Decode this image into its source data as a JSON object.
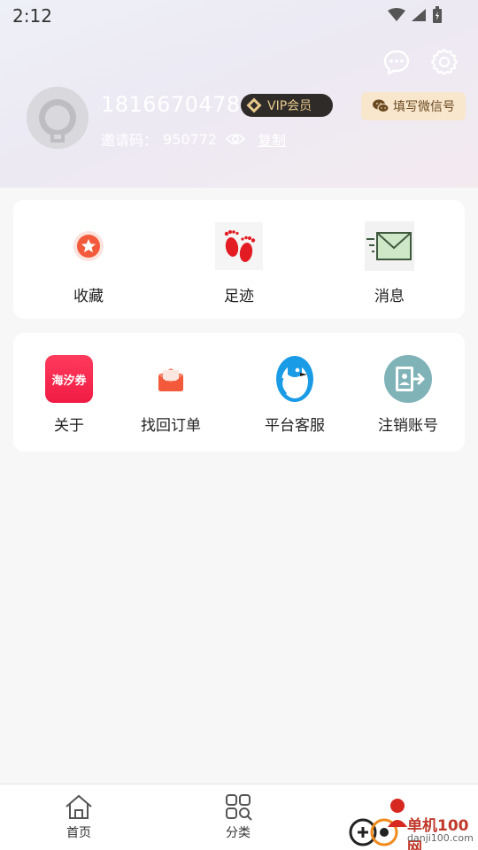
{
  "status_bar": {
    "time": "2:12"
  },
  "profile": {
    "phone": "18166704786",
    "vip_label": "VIP会员",
    "invite_label": "邀请码：",
    "invite_code": "950772",
    "copy_label": "复制",
    "wechat_button": "填写微信号"
  },
  "quick_actions": [
    {
      "label": "收藏",
      "icon": "star-badge-icon"
    },
    {
      "label": "足迹",
      "icon": "footprints-icon"
    },
    {
      "label": "消息",
      "icon": "envelope-icon"
    }
  ],
  "services": [
    {
      "label": "关于",
      "icon_text": "海汐券"
    },
    {
      "label": "找回订单",
      "icon": "envelope-open-icon"
    },
    {
      "label": "平台客服",
      "icon": "penguin-icon"
    },
    {
      "label": "注销账号",
      "icon": "logout-icon"
    }
  ],
  "tabbar": [
    {
      "label": "首页",
      "icon": "home-icon"
    },
    {
      "label": "分类",
      "icon": "grid-icon"
    }
  ],
  "watermark": {
    "title": "单机100网",
    "url": "danji100.com"
  },
  "colors": {
    "accent_red": "#f01b44",
    "vip_bg": "#2e2b29",
    "vip_text": "#e9c98c",
    "wechat_bg": "#f8e6cd"
  }
}
